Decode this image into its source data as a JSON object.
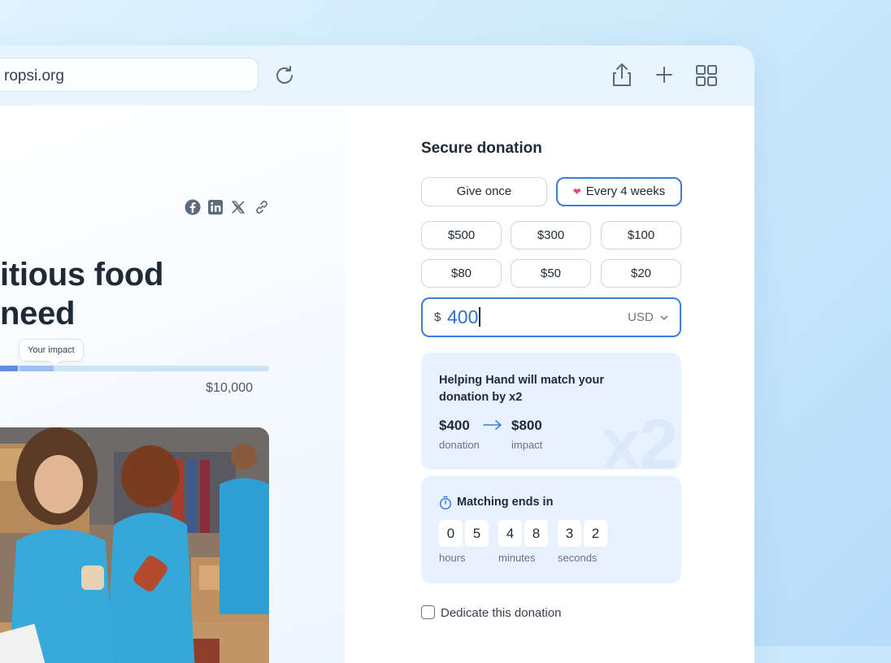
{
  "browser": {
    "url": "ropsi.org"
  },
  "campaign": {
    "headline_line1": "itious food",
    "headline_line2": "need",
    "tooltip": "Your impact",
    "goal": "$10,000",
    "progress_fraction": 0.12,
    "impact_fraction": 0.12
  },
  "donation": {
    "title": "Secure donation",
    "frequency": {
      "once_label": "Give once",
      "recurring_label": "Every 4 weeks",
      "selected": "recurring"
    },
    "amounts": [
      "$500",
      "$300",
      "$100",
      "$80",
      "$50",
      "$20"
    ],
    "input": {
      "currency_symbol": "$",
      "value": "400",
      "currency": "USD"
    },
    "match": {
      "text": "Helping Hand will match your donation by x2",
      "donation_value": "$400",
      "donation_label": "donation",
      "impact_value": "$800",
      "impact_label": "impact",
      "watermark": "x2"
    },
    "timer": {
      "title": "Matching ends in",
      "hours": [
        "0",
        "5"
      ],
      "minutes": [
        "4",
        "8"
      ],
      "seconds": [
        "3",
        "2"
      ],
      "hours_label": "hours",
      "minutes_label": "minutes",
      "seconds_label": "seconds"
    },
    "dedicate_label": "Dedicate this donation"
  },
  "colors": {
    "accent": "#3d7be0",
    "heart": "#e8457a",
    "card_bg": "#e8f2fe"
  }
}
